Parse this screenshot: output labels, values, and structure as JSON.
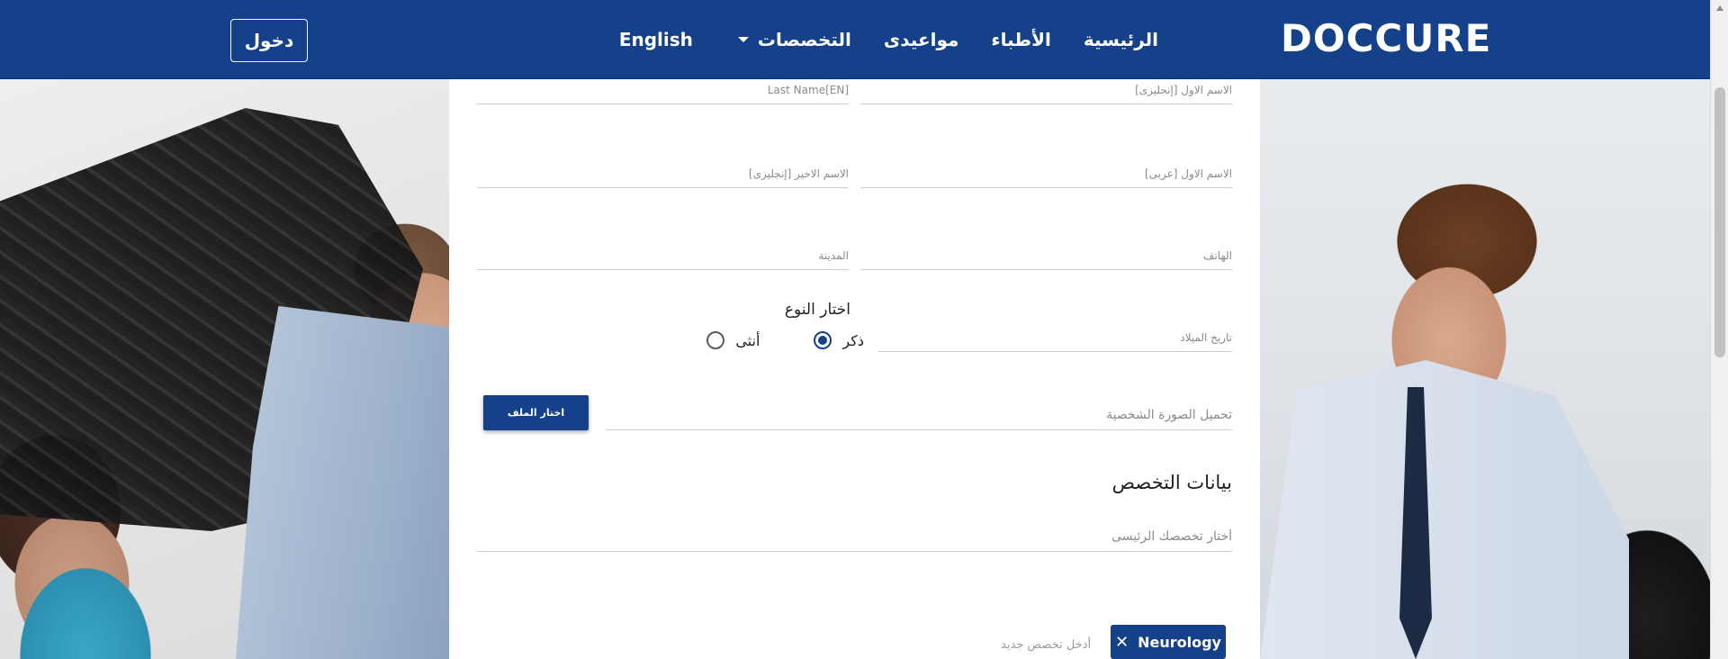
{
  "header": {
    "logo": "DOCCURE",
    "nav": [
      {
        "label": "الرئيسية"
      },
      {
        "label": "الأطباء"
      },
      {
        "label": "مواعيدى"
      },
      {
        "label": "التخصصات"
      },
      {
        "label": "English"
      }
    ],
    "login_label": "دخول"
  },
  "form": {
    "first_name_en": {
      "placeholder": "الاسم الاول [إنجليزى]"
    },
    "last_name_en_top": {
      "placeholder": "Last Name[EN]"
    },
    "first_name_ar": {
      "placeholder": "الاسم الاول [عربى]"
    },
    "last_name_en": {
      "placeholder": "الاسم الاخير [إنجليزى]"
    },
    "phone": {
      "placeholder": "الهاتف"
    },
    "city": {
      "placeholder": "المدينة"
    },
    "birth_date": {
      "placeholder": "تاريخ الميلاد"
    },
    "gender": {
      "title": "اختار النوع",
      "options": [
        {
          "label": "ذكر",
          "checked": true
        },
        {
          "label": "أنثى",
          "checked": false
        }
      ]
    },
    "photo": {
      "placeholder": "تحميل الصورة الشخصية",
      "button_label": "اختار الملف"
    },
    "specialty_section": {
      "title": "بيانات التخصص",
      "main_specialty": {
        "placeholder": "أختار تخصصك الرئيسى"
      },
      "tag": "Neurology",
      "tag_remove_icon": "close-icon",
      "new_specialty_placeholder": "أدخل تخصص جديد"
    }
  },
  "colors": {
    "primary": "#15408a",
    "accent_logo": "#ffffff"
  }
}
